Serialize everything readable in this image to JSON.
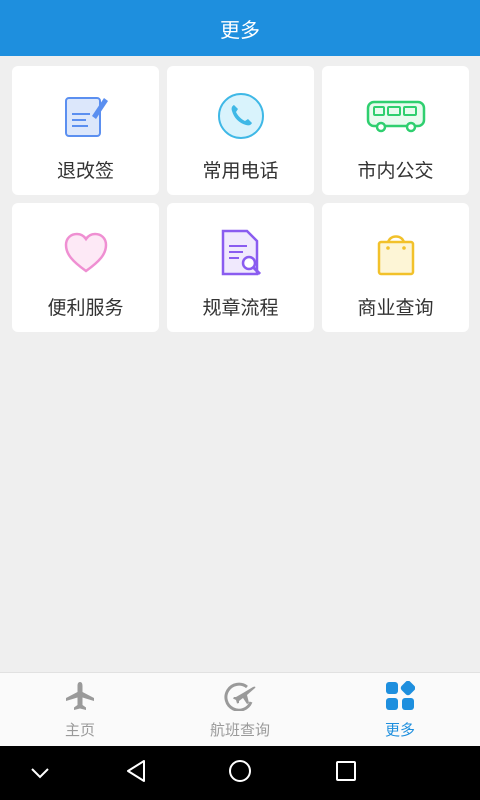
{
  "header": {
    "title": "更多"
  },
  "grid": {
    "items": [
      {
        "label": "退改签",
        "icon": "refund-edit-icon"
      },
      {
        "label": "常用电话",
        "icon": "phone-icon"
      },
      {
        "label": "市内公交",
        "icon": "bus-icon"
      },
      {
        "label": "便利服务",
        "icon": "heart-icon"
      },
      {
        "label": "规章流程",
        "icon": "document-search-icon"
      },
      {
        "label": "商业查询",
        "icon": "shopping-bag-icon"
      }
    ]
  },
  "tabbar": {
    "tabs": [
      {
        "label": "主页",
        "icon": "airplane-icon",
        "active": false
      },
      {
        "label": "航班查询",
        "icon": "flight-query-icon",
        "active": false
      },
      {
        "label": "更多",
        "icon": "grid-more-icon",
        "active": true
      }
    ]
  },
  "colors": {
    "accent": "#1e8fde",
    "tab_inactive": "#9a9a9a",
    "background": "#efefef"
  }
}
